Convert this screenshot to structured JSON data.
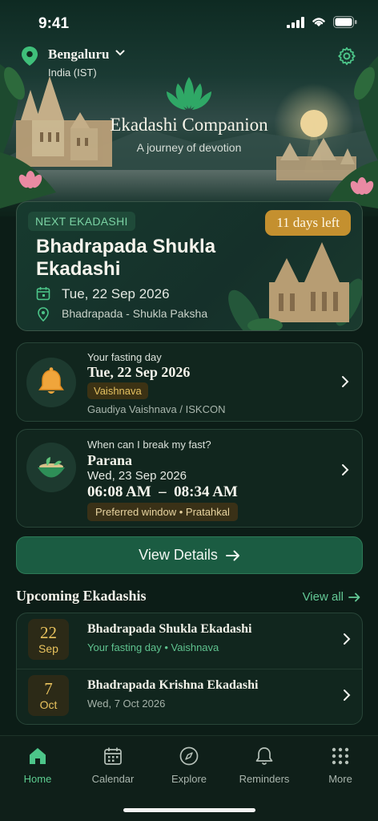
{
  "status_bar": {
    "time": "9:41"
  },
  "location": {
    "city": "Bengaluru",
    "timezone": "India (IST)"
  },
  "hero": {
    "title": "Ekadashi Companion",
    "subtitle": "A journey of devotion"
  },
  "next_ekadashi": {
    "badge": "NEXT EKADASHI",
    "days_left": "11 days left",
    "title": "Bhadrapada Shukla Ekadashi",
    "date": "Tue, 22 Sep 2026",
    "paksha": "Bhadrapada - Shukla Paksha"
  },
  "fasting": {
    "label": "Your fasting day",
    "date": "Tue, 22 Sep 2026",
    "tradition_badge": "Vaishnava",
    "tradition": "Gaudiya Vaishnava / ISKCON"
  },
  "parana": {
    "question": "When can I break my fast?",
    "title": "Parana",
    "date": "Wed, 23 Sep 2026",
    "time": "06:08 AM  –  08:34 AM",
    "window": "Preferred window • Pratahkal"
  },
  "view_details": {
    "label": "View Details"
  },
  "upcoming": {
    "title": "Upcoming Ekadashis",
    "view_all": "View all",
    "items": [
      {
        "day": "22",
        "month": "Sep",
        "name": "Bhadrapada Shukla Ekadashi",
        "sub": "Your fasting day  •  Vaishnava"
      },
      {
        "day": "7",
        "month": "Oct",
        "name": "Bhadrapada Krishna Ekadashi",
        "sub": "Wed, 7 Oct 2026"
      }
    ]
  },
  "tabs": [
    {
      "label": "Home",
      "icon": "home-icon",
      "active": true
    },
    {
      "label": "Calendar",
      "icon": "calendar-icon",
      "active": false
    },
    {
      "label": "Explore",
      "icon": "compass-icon",
      "active": false
    },
    {
      "label": "Reminders",
      "icon": "bell-icon",
      "active": false
    },
    {
      "label": "More",
      "icon": "grid-icon",
      "active": false
    }
  ],
  "colors": {
    "accent_green": "#5ccb8f",
    "gold": "#c4902f",
    "background": "#0c1d17"
  }
}
